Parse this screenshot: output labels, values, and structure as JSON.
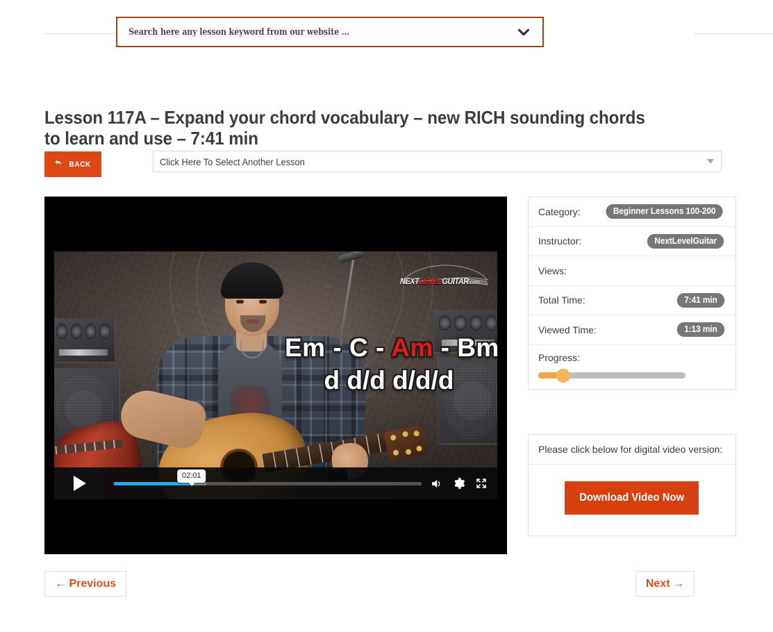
{
  "search": {
    "placeholder": "Search here any lesson keyword from our website ...",
    "chevron_icon": "chevron-down-icon",
    "border_color": "#a8401a"
  },
  "page_title": "Lesson 117A – Expand your chord vocabulary – new RICH sounding chords to learn and use – 7:41 min",
  "toolbar": {
    "back_label": "BACK",
    "back_icon": "back-arrow-icon",
    "back_color": "#dd4814",
    "lesson_select_value": "Click Here To Select Another Lesson",
    "lesson_select_icon": "triangle-down-icon"
  },
  "player": {
    "play_icon": "play-icon",
    "volume_icon": "volume-icon",
    "settings_icon": "gear-icon",
    "fullscreen_icon": "fullscreen-icon",
    "time_tooltip": "02:01",
    "played_percent": 26.5,
    "buffered_percent": 30,
    "progress_color": "#2aa7e8",
    "overlay": {
      "chords_prefix": "Em - C - ",
      "chords_highlight": "Am",
      "chords_suffix": " - Bm",
      "strumming": "d  d/d  d/d/d",
      "highlight_color": "#e11b12"
    },
    "watermark": {
      "part1": "NEXT",
      "part2": "LEVEL",
      "part3": "GUITAR",
      "part4": ".com"
    }
  },
  "info": {
    "rows": [
      {
        "label": "Category:",
        "badge": "Beginner Lessons 100-200"
      },
      {
        "label": "Instructor:",
        "badge": "NextLevelGuitar"
      },
      {
        "label": "Views:",
        "badge": ""
      },
      {
        "label": "Total Time:",
        "badge": "7:41 min"
      },
      {
        "label": "Viewed Time:",
        "badge": "1:13 min"
      }
    ],
    "progress_label": "Progress:",
    "progress_percent": 17,
    "progress_fill_color": "#eda94a",
    "badge_color": "#777777"
  },
  "download": {
    "heading": "Please click below for digital video version:",
    "button_label": "Download Video Now",
    "button_color": "#d9400f"
  },
  "pagination": {
    "previous_label": "← Previous",
    "next_label": "Next →",
    "accent_color": "#d9511c"
  }
}
